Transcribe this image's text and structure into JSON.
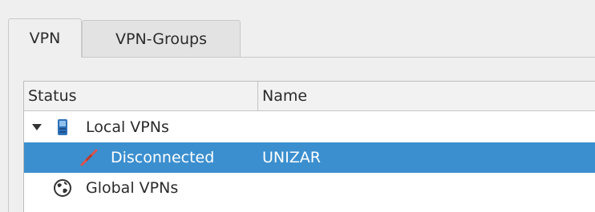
{
  "tabs": [
    {
      "label": "VPN",
      "active": true
    },
    {
      "label": "VPN-Groups",
      "active": false
    }
  ],
  "tree": {
    "columns": [
      "Status",
      "Name"
    ],
    "rows": [
      {
        "status": "Local VPNs",
        "name": "",
        "icon": "local-vpn-icon",
        "expanded": true
      },
      {
        "status": "Disconnected",
        "name": "UNIZAR",
        "icon": "disconnected-icon",
        "selected": true
      },
      {
        "status": "Global VPNs",
        "name": "",
        "icon": "globe-icon"
      }
    ]
  },
  "colors": {
    "selection": "#3b8fcf",
    "disconnected_icon": "#d9534f",
    "local_vpn_icon": "#2d6fb8"
  }
}
